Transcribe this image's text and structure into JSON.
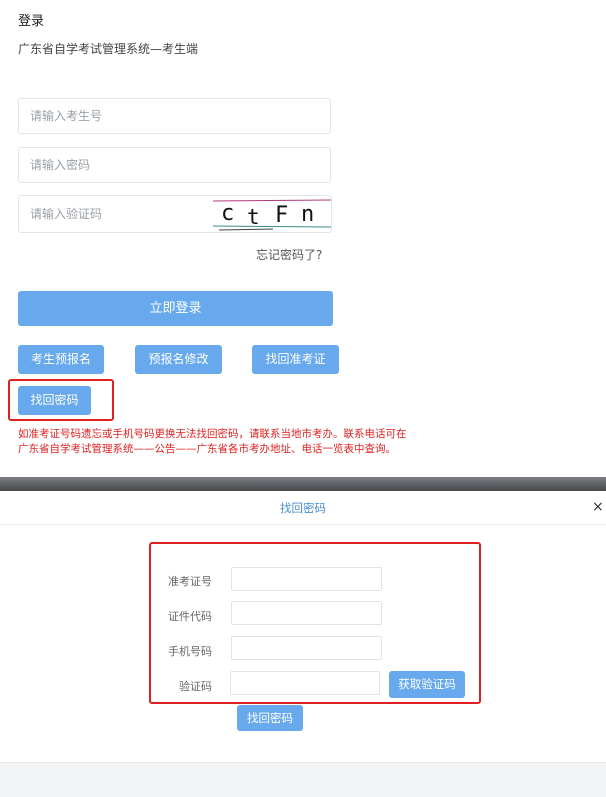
{
  "login": {
    "title": "登录",
    "subtitle": "广东省自学考试管理系统—考生端",
    "exam_no_placeholder": "请输入考生号",
    "password_placeholder": "请输入密码",
    "captcha_placeholder": "请输入验证码",
    "captcha_text": [
      "c",
      "t",
      "F",
      "n"
    ],
    "forgot_label": "忘记密码了?",
    "submit_label": "立即登录",
    "buttons": [
      "考生预报名",
      "预报名修改",
      "找回准考证"
    ],
    "find_password_label": "找回密码",
    "notice_line1": "如准考证号码遗忘或手机号码更换无法找回密码，请联系当地市考办。联系电话可在",
    "notice_line2": "广东省自学考试管理系统——公告——广东省各市考办地址、电话一览表中查询。"
  },
  "modal": {
    "title": "找回密码",
    "close": "×",
    "fields": {
      "ticket_label": "准考证号",
      "id_label": "证件代码",
      "phone_label": "手机号码",
      "code_label": "验证码"
    },
    "get_code_label": "获取验证码",
    "submit_label": "找回密码"
  },
  "colors": {
    "accent": "#67a9ec",
    "highlight": "#e02020",
    "notice": "#dd2222"
  }
}
